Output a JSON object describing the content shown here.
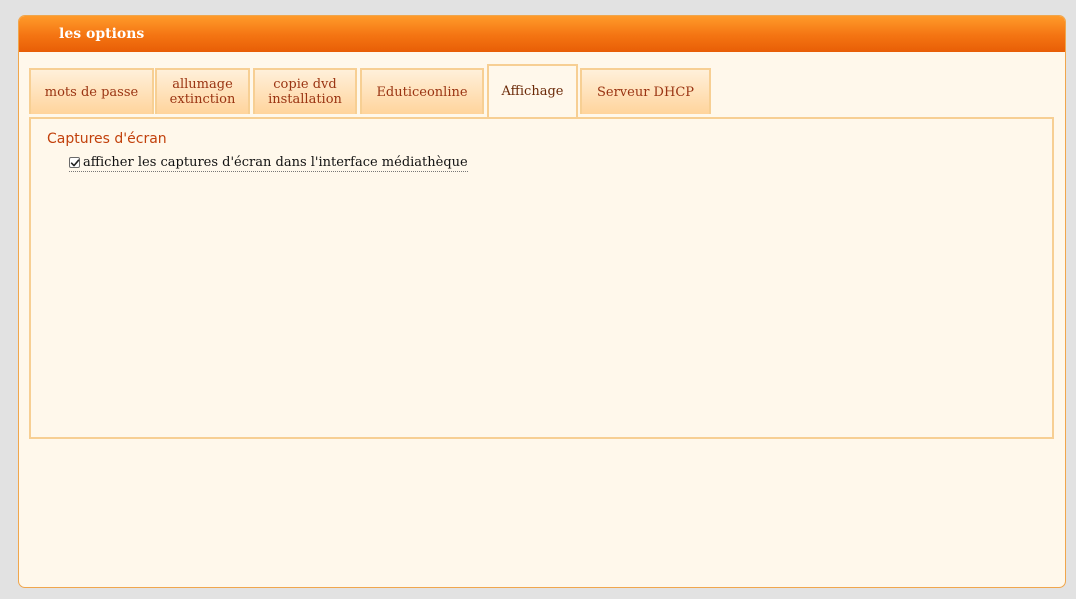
{
  "window": {
    "title": "les options"
  },
  "tabs": [
    {
      "label": "mots de passe",
      "active": false
    },
    {
      "label": "allumage\nextinction",
      "active": false
    },
    {
      "label": "copie dvd\ninstallation",
      "active": false
    },
    {
      "label": "Eduticeonline",
      "active": false
    },
    {
      "label": "Affichage",
      "active": true
    },
    {
      "label": "Serveur DHCP",
      "active": false
    }
  ],
  "panel": {
    "section_title": "Captures d'écran",
    "options": [
      {
        "label": "afficher les captures d'écran dans l'interface médiathèque",
        "checked": true
      }
    ]
  },
  "colors": {
    "titlebar": "#f47412",
    "tab_text": "#9a3412",
    "section_title": "#c2410c",
    "background": "#fff8eb"
  }
}
